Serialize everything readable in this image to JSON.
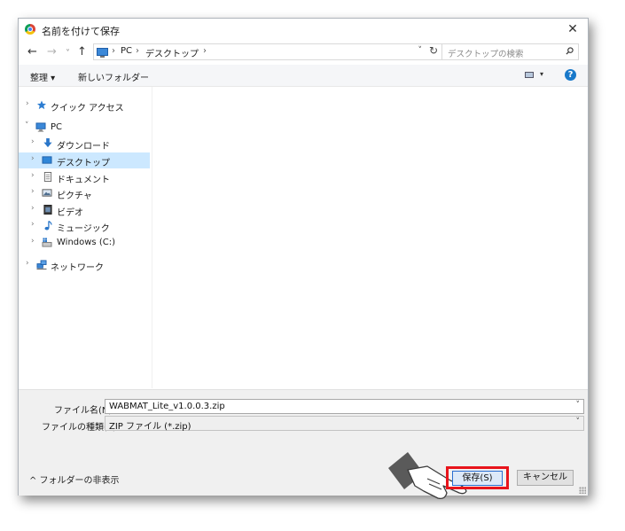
{
  "window": {
    "title": "名前を付けて保存",
    "close_glyph": "✕"
  },
  "nav": {
    "back_glyph": "←",
    "forward_glyph": "→",
    "recent_glyph": "˅",
    "up_glyph": "↑",
    "breadcrumbs": [
      "PC",
      "デスクトップ"
    ],
    "crumb_sep": "›",
    "address_dropdown_glyph": "˅",
    "refresh_glyph": "↻",
    "search_placeholder": "デスクトップの検索"
  },
  "toolbar": {
    "organize_label": "整理 ▾",
    "new_folder_label": "新しいフォルダー",
    "view_dropdown": "▾",
    "help_glyph": "?"
  },
  "tree": [
    {
      "label": "クイック アクセス",
      "icon": "star-icon",
      "chevron": "›"
    },
    {
      "label": "PC",
      "icon": "pc-icon",
      "chevron": "˅"
    },
    {
      "label": "ダウンロード",
      "icon": "download-icon",
      "chevron": "›"
    },
    {
      "label": "デスクトップ",
      "icon": "desktop-icon",
      "chevron": "›"
    },
    {
      "label": "ドキュメント",
      "icon": "document-icon",
      "chevron": "›"
    },
    {
      "label": "ピクチャ",
      "icon": "picture-icon",
      "chevron": "›"
    },
    {
      "label": "ビデオ",
      "icon": "video-icon",
      "chevron": "›"
    },
    {
      "label": "ミュージック",
      "icon": "music-icon",
      "chevron": "›"
    },
    {
      "label": "Windows (C:)",
      "icon": "drive-icon",
      "chevron": "›"
    },
    {
      "label": "ネットワーク",
      "icon": "network-icon",
      "chevron": "›"
    }
  ],
  "form": {
    "filename_label": "ファイル名(N):",
    "filename_value": "WABMAT_Lite_v1.0.0.3.zip",
    "filetype_label": "ファイルの種類(T):",
    "filetype_value": "ZIP ファイル (*.zip)",
    "dropdown_glyph": "˅"
  },
  "buttons": {
    "hide_folders_label": "^ フォルダーの非表示",
    "save_label": "保存(S)",
    "cancel_label": "キャンセル"
  },
  "colors": {
    "accent": "#1979ca",
    "selected": "#cce8ff",
    "highlight": "#e8141b"
  }
}
